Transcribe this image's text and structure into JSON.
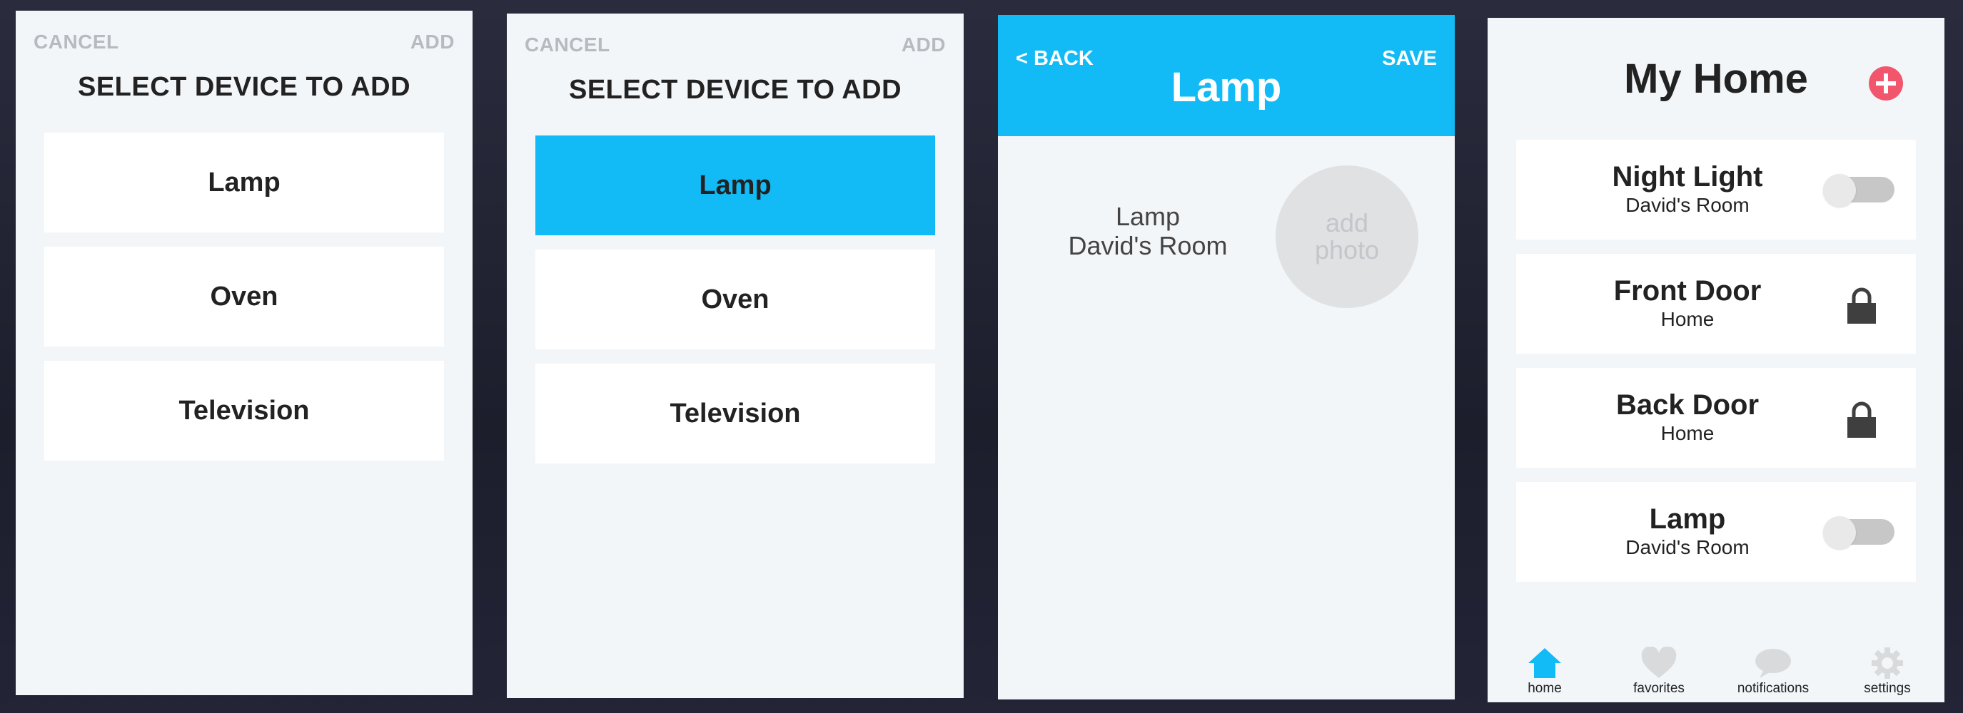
{
  "screen_select_1": {
    "cancel_label": "CANCEL",
    "add_label": "ADD",
    "title": "SELECT DEVICE TO ADD",
    "devices": [
      "Lamp",
      "Oven",
      "Television"
    ]
  },
  "screen_select_2": {
    "cancel_label": "CANCEL",
    "add_label": "ADD",
    "title": "SELECT DEVICE TO ADD",
    "devices": [
      "Lamp",
      "Oven",
      "Television"
    ],
    "selected_device": "Lamp"
  },
  "screen_detail": {
    "back_label": "< BACK",
    "save_label": "SAVE",
    "title": "Lamp",
    "device_name": "Lamp",
    "device_room": "David's Room",
    "photo_line1": "add",
    "photo_line2": "photo"
  },
  "screen_home": {
    "title": "My Home",
    "add_icon": "plus-circle-icon",
    "devices": [
      {
        "name": "Night Light",
        "location": "David's Room",
        "control": "toggle",
        "state": "off"
      },
      {
        "name": "Front Door",
        "location": "Home",
        "control": "lock",
        "state": "locked"
      },
      {
        "name": "Back Door",
        "location": "Home",
        "control": "lock",
        "state": "locked"
      },
      {
        "name": "Lamp",
        "location": "David's Room",
        "control": "toggle",
        "state": "off"
      }
    ],
    "nav": [
      {
        "label": "home",
        "icon": "home-icon",
        "active": true
      },
      {
        "label": "favorites",
        "icon": "heart-icon",
        "active": false
      },
      {
        "label": "notifications",
        "icon": "speech-bubble-icon",
        "active": false
      },
      {
        "label": "settings",
        "icon": "gear-icon",
        "active": false
      }
    ]
  },
  "colors": {
    "accent_blue": "#12bbf5",
    "add_red": "#f2566d",
    "screen_bg": "#f3f6f9",
    "muted_header_text": "#b7bbc0",
    "icon_inactive": "#d8dadc"
  }
}
